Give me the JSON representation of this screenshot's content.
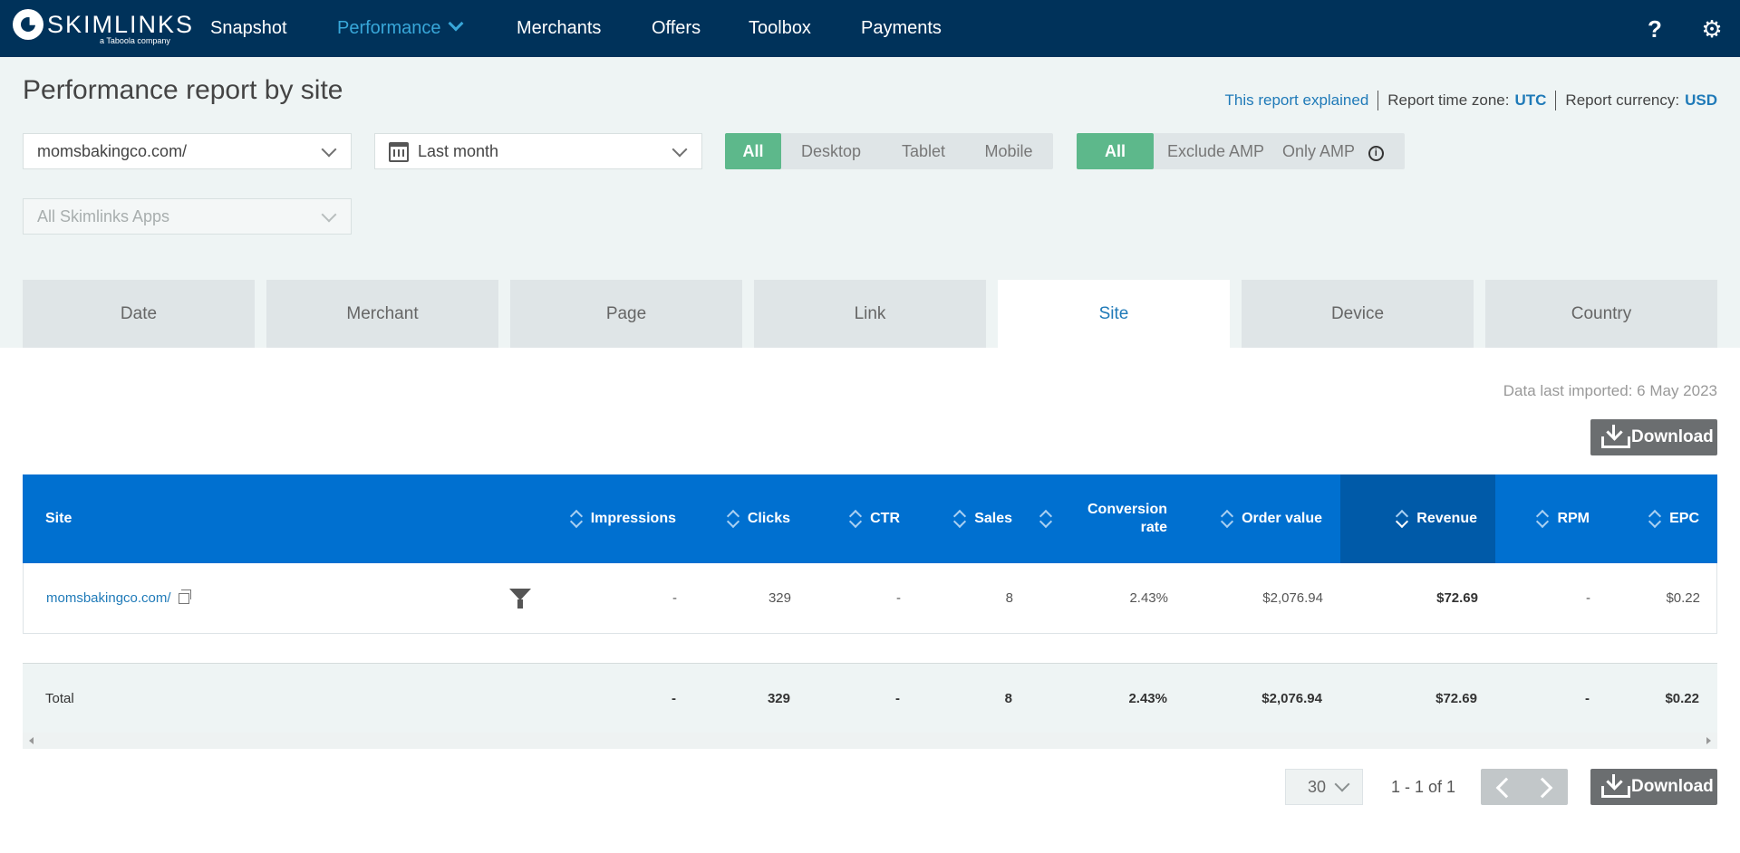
{
  "nav": {
    "logo_text": "SKIMLINKS",
    "logo_sub": "a Taboola company",
    "items": [
      {
        "label": "Snapshot"
      },
      {
        "label": "Performance",
        "active": true
      },
      {
        "label": "Merchants"
      },
      {
        "label": "Offers"
      },
      {
        "label": "Toolbox"
      },
      {
        "label": "Payments"
      }
    ],
    "icons": [
      "help-icon",
      "gear-icon"
    ]
  },
  "header": {
    "title": "Performance report by site",
    "explained_link": "This report explained",
    "timezone_label": "Report time zone:",
    "timezone_value": "UTC",
    "currency_label": "Report currency:",
    "currency_value": "USD"
  },
  "filters": {
    "site_select": "momsbakingco.com/",
    "date_select": "Last month",
    "apps_select": "All Skimlinks Apps",
    "device_options": [
      "All",
      "Desktop",
      "Tablet",
      "Mobile"
    ],
    "device_selected": "All",
    "amp_options": [
      "All",
      "Exclude AMP",
      "Only AMP"
    ],
    "amp_selected": "All",
    "info_glyph": "i"
  },
  "tabs": [
    "Date",
    "Merchant",
    "Page",
    "Link",
    "Site",
    "Device",
    "Country"
  ],
  "active_tab": "Site",
  "data_imported": "Data last imported: 6 May 2023",
  "download_label": "Download",
  "table": {
    "columns": [
      "Site",
      "Impressions",
      "Clicks",
      "CTR",
      "Sales",
      "Conversion",
      "rate",
      "Order value",
      "Revenue",
      "RPM",
      "EPC"
    ],
    "sorted_column": "Revenue",
    "rows": [
      {
        "site": "momsbakingco.com/",
        "impressions": "-",
        "clicks": "329",
        "ctr": "-",
        "sales": "8",
        "conversion_rate": "2.43%",
        "order_value": "$2,076.94",
        "revenue": "$72.69",
        "rpm": "-",
        "epc": "$0.22"
      }
    ],
    "total": {
      "label": "Total",
      "impressions": "-",
      "clicks": "329",
      "ctr": "-",
      "sales": "8",
      "conversion_rate": "2.43%",
      "order_value": "$2,076.94",
      "revenue": "$72.69",
      "rpm": "-",
      "epc": "$0.22"
    }
  },
  "pager": {
    "per_page": "30",
    "range": "1 - 1 of 1"
  },
  "colors": {
    "nav_bg": "#00325a",
    "accent": "#38a7d9",
    "table_header": "#0070d0",
    "table_header_sorted": "#005aa8",
    "toggle_on": "#5db88b",
    "link": "#1f7ab8"
  }
}
